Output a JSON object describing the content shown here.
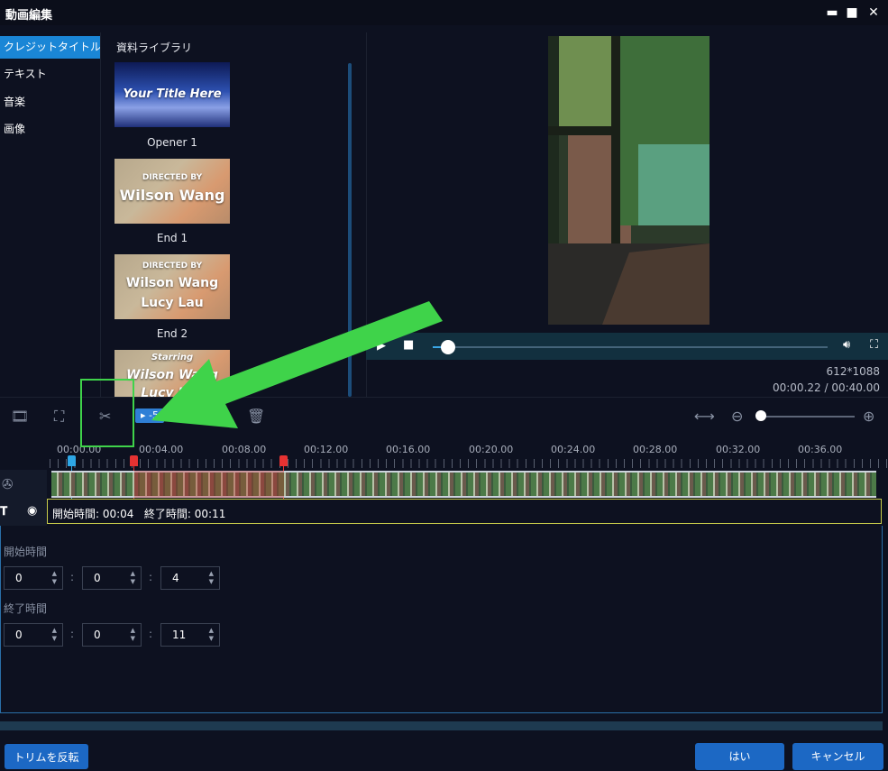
{
  "window": {
    "title": "動画編集",
    "controls": [
      "▬",
      "■",
      "✕"
    ]
  },
  "categories": [
    {
      "label": "クレジットタイトル",
      "active": true
    },
    {
      "label": "テキスト",
      "active": false
    },
    {
      "label": "音楽",
      "active": false
    },
    {
      "label": "画像",
      "active": false
    }
  ],
  "library": {
    "title": "資料ライブラリ",
    "items": [
      {
        "label": "Opener 1",
        "thumb_lines": [
          "Your Title Here"
        ]
      },
      {
        "label": "End 1",
        "thumb_lines": [
          "DIRECTED BY",
          "Wilson Wang"
        ]
      },
      {
        "label": "End 2",
        "thumb_lines": [
          "DIRECTED BY",
          "Wilson Wang",
          "Lucy Lau"
        ]
      },
      {
        "label": "",
        "thumb_lines": [
          "Starring",
          "Wilson Wang",
          "Lucy Lau"
        ]
      }
    ]
  },
  "preview": {
    "resolution": "612*1088",
    "timecode": "00:00.22 / 00:40.00",
    "progress_fraction": 0.0055
  },
  "toolbar": {
    "speed_badge": "▸ ‑5",
    "zoom_fraction": 0.03
  },
  "timeline": {
    "ticks": [
      "00:00.00",
      "00:04.00",
      "00:08.00",
      "00:12.00",
      "00:16.00",
      "00:20.00",
      "00:24.00",
      "00:28.00",
      "00:32.00",
      "00:36.00"
    ],
    "clip_info": "開始時間: 00:04   終了時間: 00:11"
  },
  "trim": {
    "start_label": "開始時間",
    "start": [
      "0",
      "0",
      "4"
    ],
    "end_label": "終了時間",
    "end": [
      "0",
      "0",
      "11"
    ]
  },
  "buttons": {
    "reverse": "トリムを反転",
    "ok": "はい",
    "cancel": "キャンセル"
  },
  "colors": {
    "accent": "#1a86d6",
    "button": "#1c68c4",
    "annotation": "#3fd34a",
    "marker_start": "#e63232",
    "playhead": "#2ea7e6"
  }
}
